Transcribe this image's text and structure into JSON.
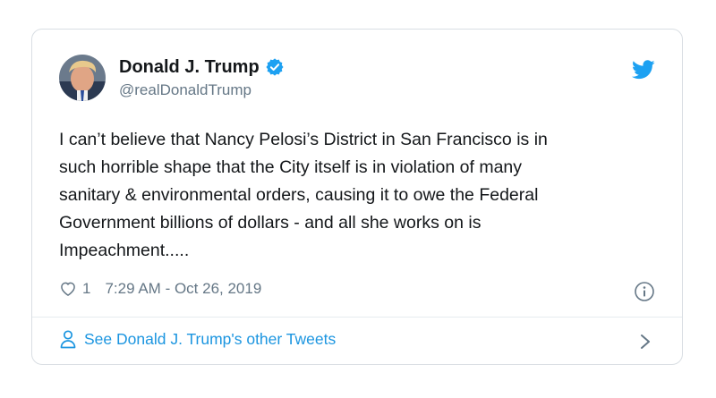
{
  "tweet": {
    "display_name": "Donald J. Trump",
    "handle": "@realDonaldTrump",
    "verified": true,
    "text": "I can’t believe that Nancy Pelosi’s District in San Francisco is in\nsuch horrible shape that the City itself is in violation of many\nsanitary & environmental orders, causing it to owe the Federal\nGovernment billions of dollars - and all she works on is\nImpeachment.....",
    "like_count": "1",
    "timestamp": "7:29 AM - Oct 26, 2019"
  },
  "footer": {
    "link_label": "See Donald J. Trump's other Tweets"
  },
  "icons": {
    "verified": "verified-badge-icon",
    "brand": "twitter-bird-icon",
    "like": "heart-outline-icon",
    "info": "info-circle-icon",
    "profile": "person-icon",
    "chevron": "chevron-right-icon"
  },
  "colors": {
    "accent": "#1da1f2",
    "link": "#1b95e0",
    "text": "#14171a",
    "secondary": "#657786",
    "border": "#d9dee3"
  }
}
